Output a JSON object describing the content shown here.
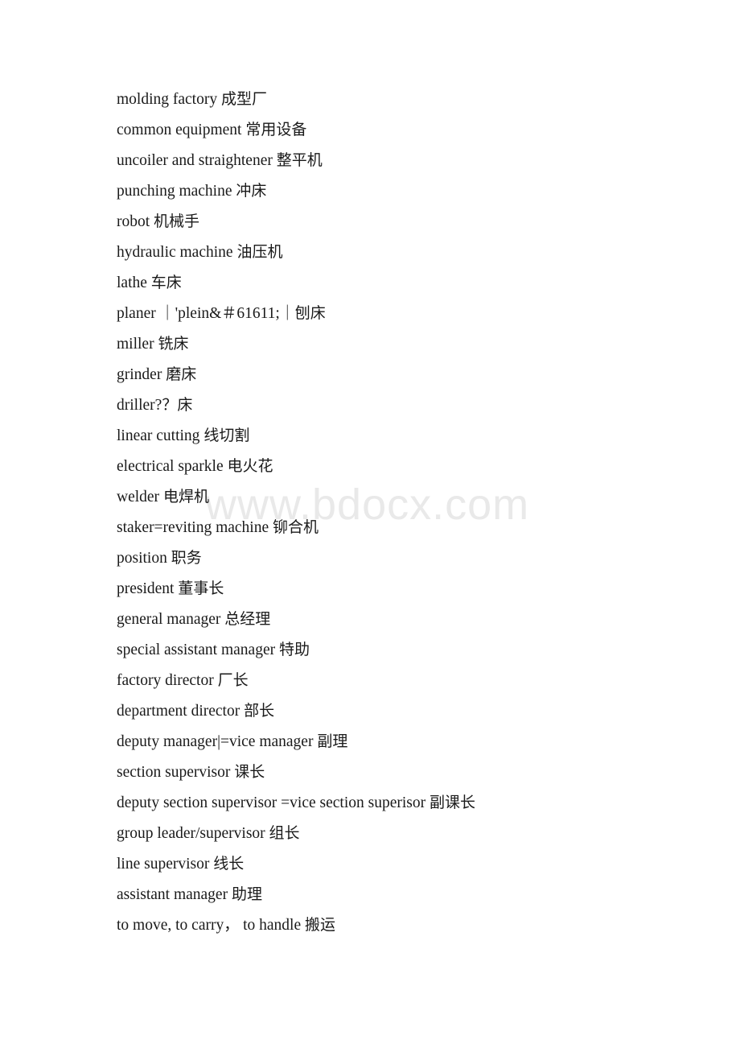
{
  "document": {
    "background_color": "#ffffff",
    "text_color": "#1a1a1a",
    "watermark": {
      "text": "www.bdocx.com",
      "color": "#e9e9e9"
    },
    "lines": [
      {
        "text": "molding factory 成型厂"
      },
      {
        "text": "common equipment 常用设备"
      },
      {
        "text": "uncoiler and straightener 整平机"
      },
      {
        "text": "punching machine 冲床"
      },
      {
        "text": "robot 机械手"
      },
      {
        "text": "hydraulic machine 油压机"
      },
      {
        "text": "lathe 车床"
      },
      {
        "text": "planer ｜'plein&＃61611;｜刨床"
      },
      {
        "text": "miller 铣床"
      },
      {
        "text": "grinder 磨床"
      },
      {
        "text": "driller?？床"
      },
      {
        "text": "linear cutting 线切割"
      },
      {
        "text": "electrical sparkle 电火花"
      },
      {
        "text": "welder 电焊机"
      },
      {
        "text": "staker=reviting machine 铆合机"
      },
      {
        "text": "position 职务"
      },
      {
        "text": "president 董事长"
      },
      {
        "text": "general manager 总经理"
      },
      {
        "text": "special assistant manager 特助"
      },
      {
        "text": "factory director 厂长"
      },
      {
        "text": "department director 部长"
      },
      {
        "text": "deputy manager|=vice manager 副理"
      },
      {
        "text": "section supervisor 课长"
      },
      {
        "text": "deputy section supervisor =vice section superisor 副课长"
      },
      {
        "text": "group leader/supervisor 组长"
      },
      {
        "text": "line supervisor 线长"
      },
      {
        "text": "assistant manager 助理"
      },
      {
        "text": "to move, to carry，  to handle 搬运"
      }
    ]
  }
}
